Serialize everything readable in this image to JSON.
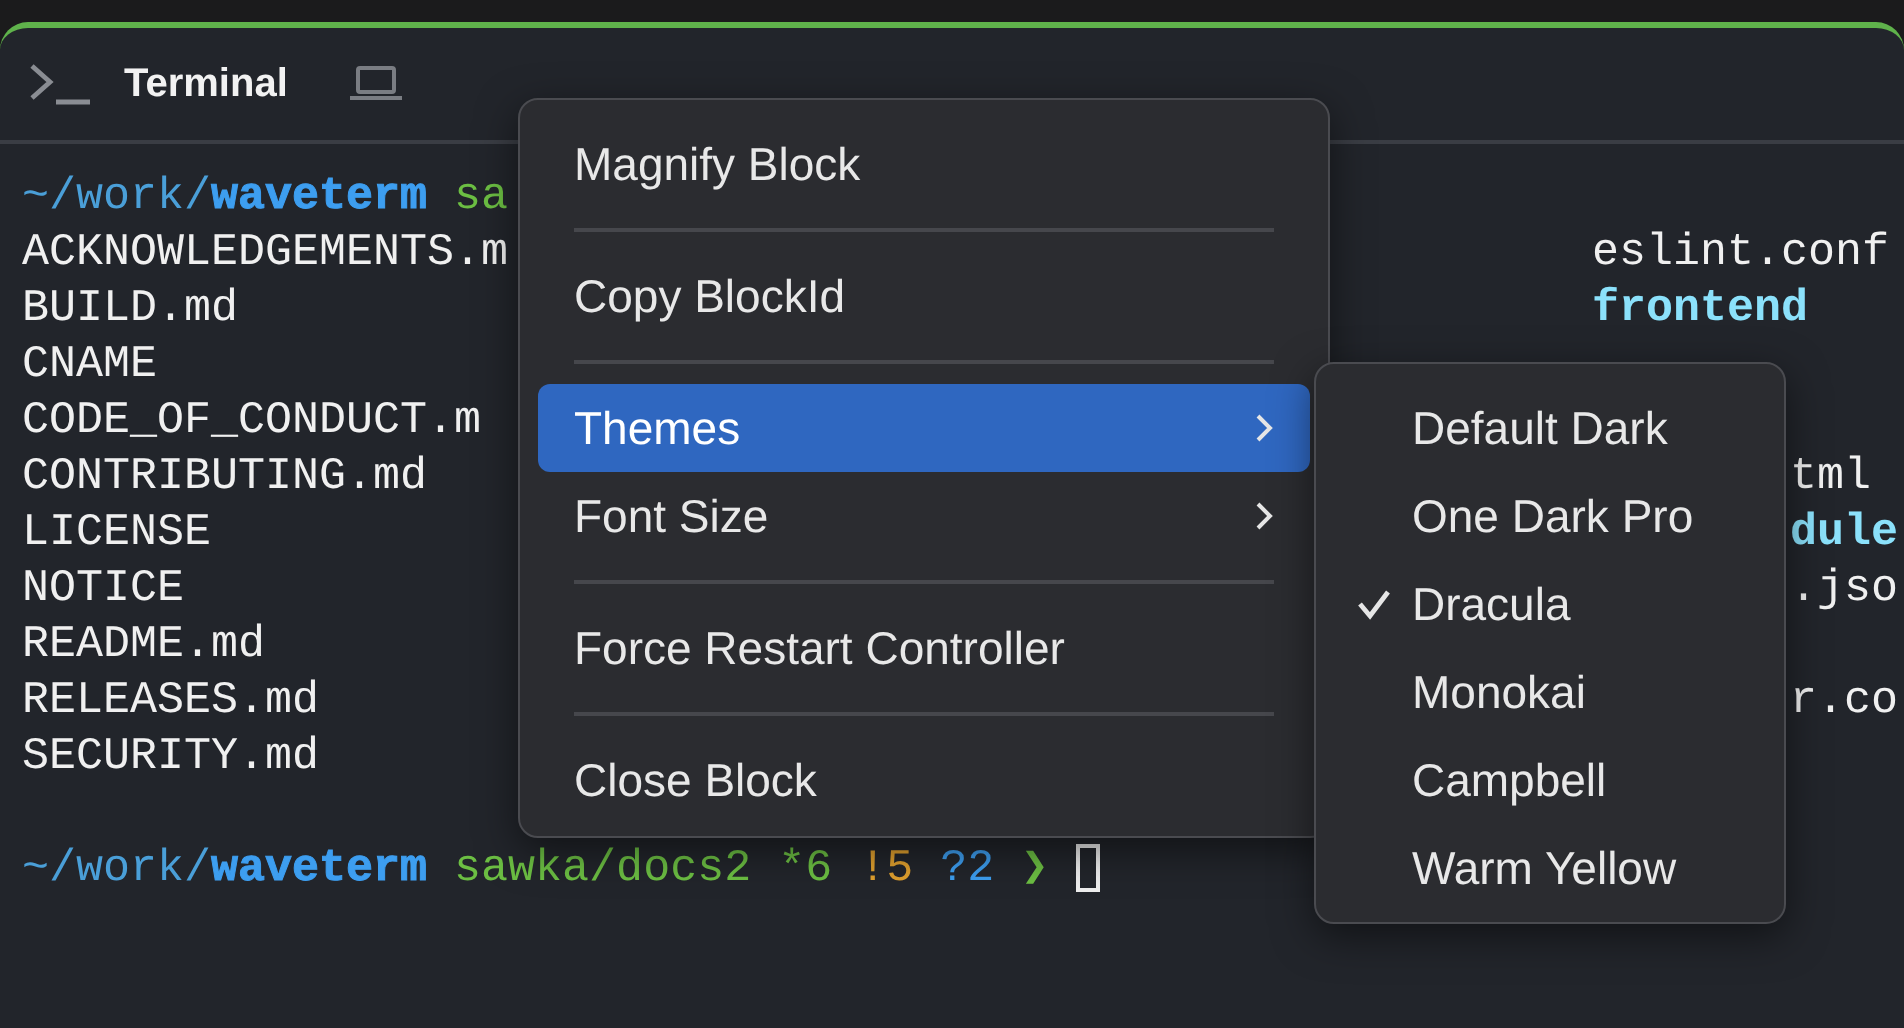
{
  "block": {
    "title": "Terminal"
  },
  "terminal": {
    "lines": [
      {
        "kind": "prompt",
        "cursor": false,
        "segments": [
          {
            "text": "~/work/",
            "color": "#4a9fd8",
            "bold": false
          },
          {
            "text": "waveterm",
            "color": "#3d9ef0",
            "bold": true
          },
          {
            "text": " sa",
            "color": "#6cbf43",
            "bold": false
          }
        ]
      },
      {
        "kind": "file",
        "text": "ACKNOWLEDGEMENTS.m",
        "right": {
          "text": "eslint.conf",
          "kind": "file",
          "after_menu": false
        }
      },
      {
        "kind": "file",
        "text": "BUILD.md",
        "right": {
          "text": "frontend",
          "kind": "dir",
          "after_menu": false
        }
      },
      {
        "kind": "file",
        "text": "CNAME"
      },
      {
        "kind": "file",
        "text": "CODE_OF_CONDUCT.m"
      },
      {
        "kind": "file",
        "text": "CONTRIBUTING.md",
        "right": {
          "text": "tml",
          "kind": "file",
          "after_menu": true
        }
      },
      {
        "kind": "file",
        "text": "LICENSE",
        "right": {
          "text": "dule",
          "kind": "dir",
          "after_menu": true
        }
      },
      {
        "kind": "file",
        "text": "NOTICE",
        "right": {
          "text": ".jso",
          "kind": "file",
          "after_menu": true
        }
      },
      {
        "kind": "file",
        "text": "README.md"
      },
      {
        "kind": "file",
        "text": "RELEASES.md",
        "right": {
          "text": "r.co",
          "kind": "file",
          "after_menu": true
        }
      },
      {
        "kind": "file",
        "text": "SECURITY.md"
      },
      {
        "kind": "blank"
      },
      {
        "kind": "prompt",
        "cursor": true,
        "segments": [
          {
            "text": "~/work/",
            "color": "#4a9fd8",
            "bold": false
          },
          {
            "text": "waveterm",
            "color": "#3d9ef0",
            "bold": true
          },
          {
            "text": " sawka/docs2 *6",
            "color": "#6cbf43",
            "bold": false
          },
          {
            "text": " !5",
            "color": "#e0a02e",
            "bold": false
          },
          {
            "text": " ?2",
            "color": "#3d9ef0",
            "bold": false
          },
          {
            "text": " ❯",
            "color": "#6cbf43",
            "bold": false
          }
        ]
      }
    ]
  },
  "context_menu": {
    "groups": [
      [
        {
          "label": "Magnify Block",
          "selected": false,
          "submenu": false
        }
      ],
      [
        {
          "label": "Copy BlockId",
          "selected": false,
          "submenu": false
        }
      ],
      [
        {
          "label": "Themes",
          "selected": true,
          "submenu": true
        },
        {
          "label": "Font Size",
          "selected": false,
          "submenu": true
        }
      ],
      [
        {
          "label": "Force Restart Controller",
          "selected": false,
          "submenu": false
        }
      ],
      [
        {
          "label": "Close Block",
          "selected": false,
          "submenu": false
        }
      ]
    ]
  },
  "themes_submenu": {
    "items": [
      {
        "label": "Default Dark",
        "checked": false
      },
      {
        "label": "One Dark Pro",
        "checked": false
      },
      {
        "label": "Dracula",
        "checked": true
      },
      {
        "label": "Monokai",
        "checked": false
      },
      {
        "label": "Campbell",
        "checked": false
      },
      {
        "label": "Warm Yellow",
        "checked": false
      }
    ]
  }
}
